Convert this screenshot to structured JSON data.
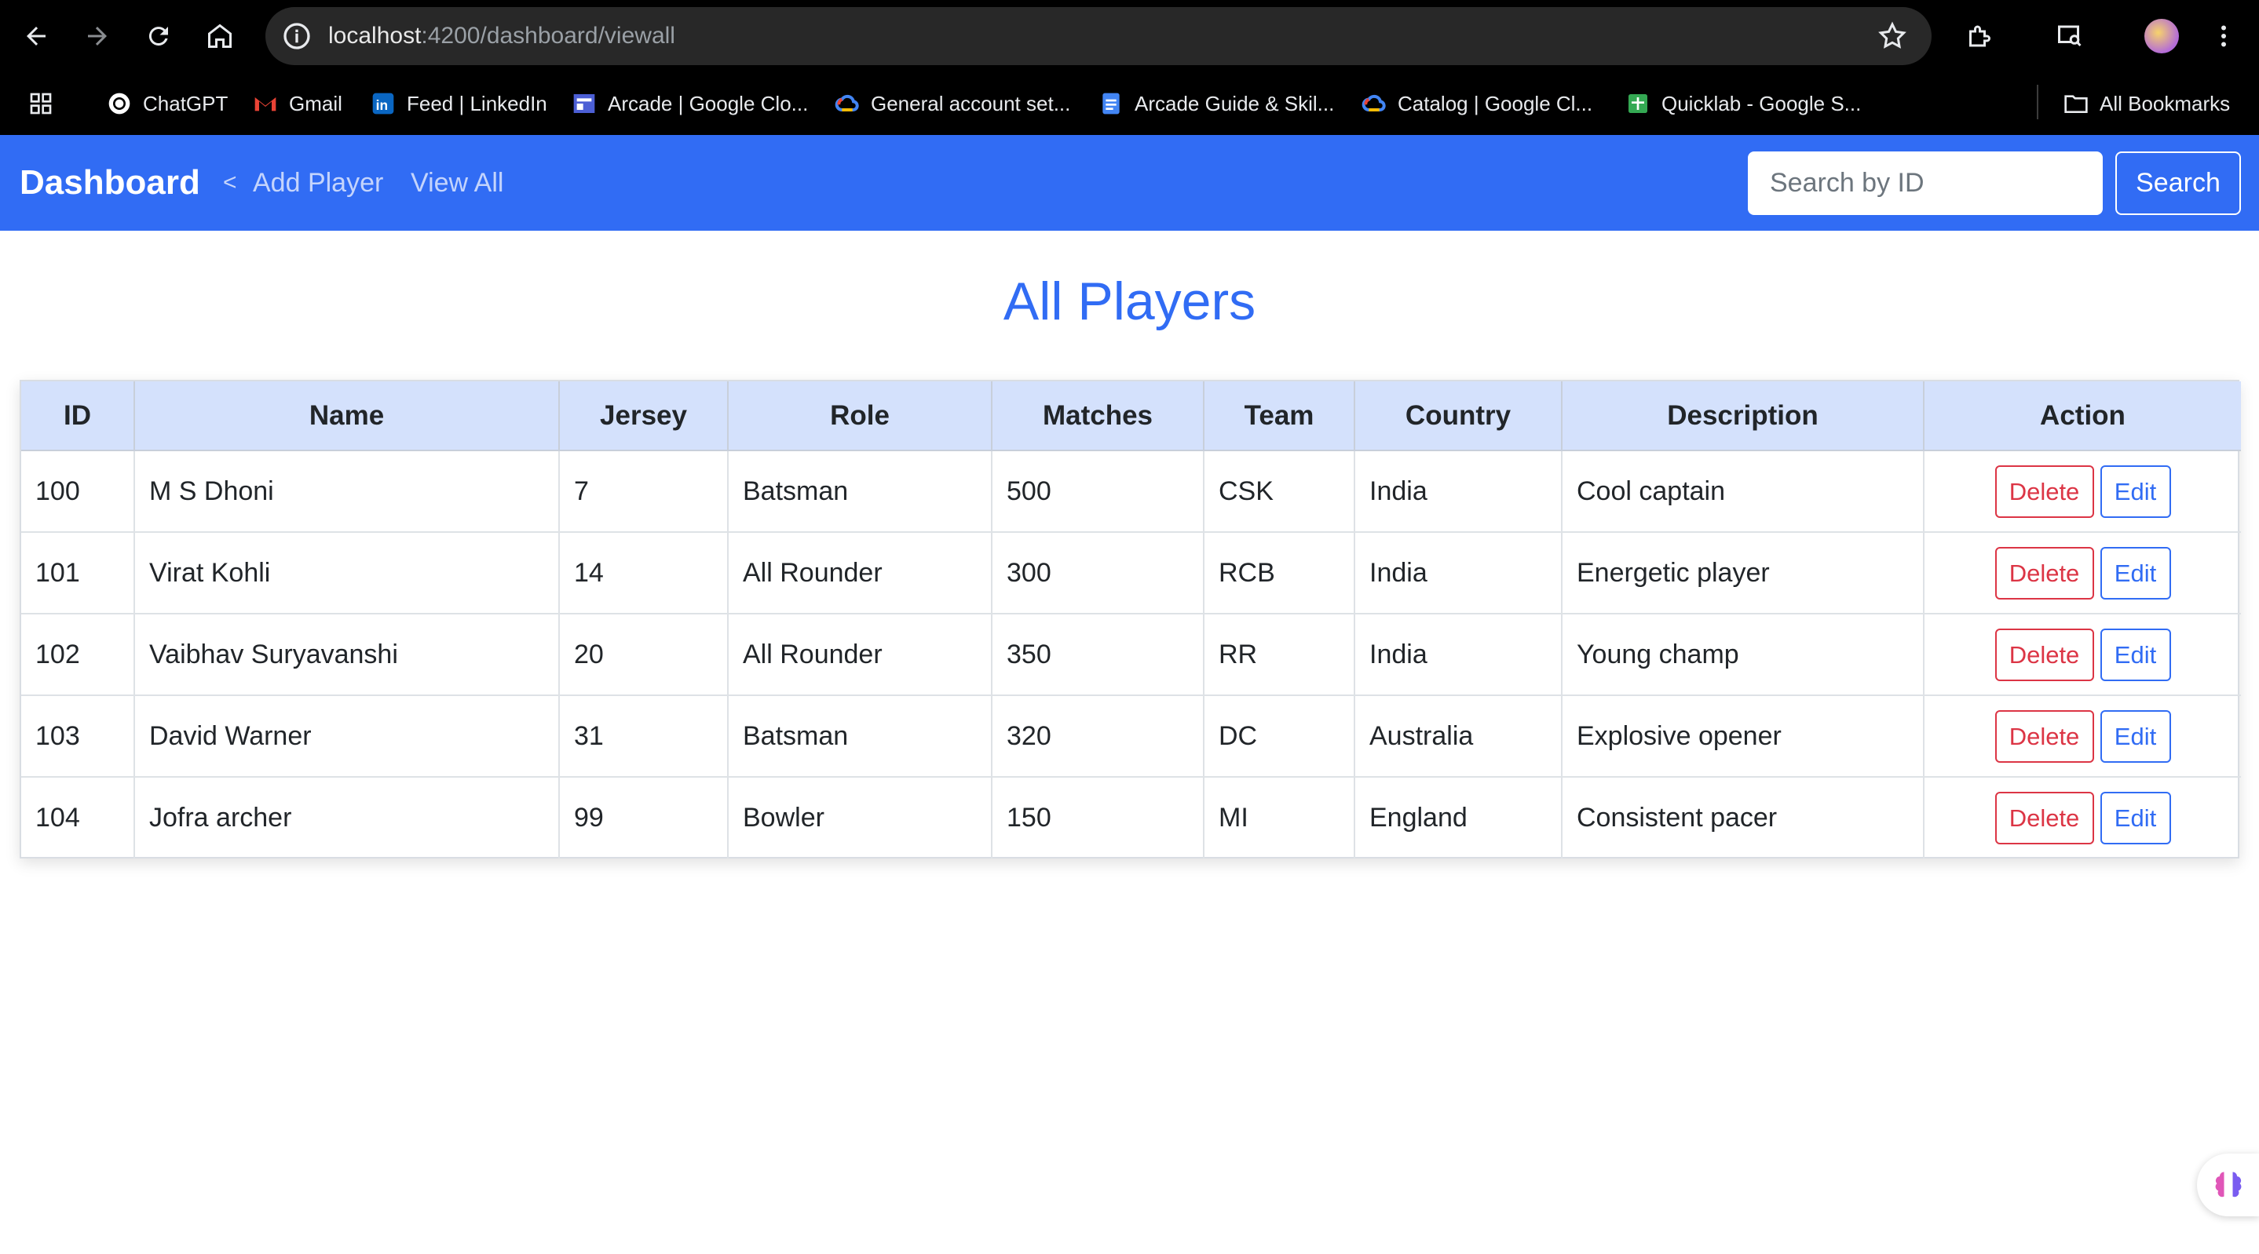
{
  "browser": {
    "url_host": "localhost",
    "url_path": ":4200/dashboard/viewall",
    "bookmarks": [
      {
        "label": "ChatGPT",
        "icon": "chatgpt-icon"
      },
      {
        "label": "Gmail",
        "icon": "gmail-icon"
      },
      {
        "label": "Feed | LinkedIn",
        "icon": "linkedin-icon"
      },
      {
        "label": "Arcade | Google Clo...",
        "icon": "arcade-icon"
      },
      {
        "label": "General account set...",
        "icon": "google-cloud-icon"
      },
      {
        "label": "Arcade Guide & Skil...",
        "icon": "docs-icon"
      },
      {
        "label": "Catalog | Google Cl...",
        "icon": "google-cloud-icon"
      },
      {
        "label": "Quicklab - Google S...",
        "icon": "sheets-icon"
      }
    ],
    "all_bookmarks": "All Bookmarks"
  },
  "navbar": {
    "brand": "Dashboard",
    "chevron": "<",
    "links": [
      "Add Player",
      "View All"
    ],
    "search_placeholder": "Search by ID",
    "search_button": "Search"
  },
  "page": {
    "title": "All Players"
  },
  "table": {
    "headers": [
      "ID",
      "Name",
      "Jersey",
      "Role",
      "Matches",
      "Team",
      "Country",
      "Description",
      "Action"
    ],
    "rows": [
      {
        "id": "100",
        "name": "M S Dhoni",
        "jersey": "7",
        "role": "Batsman",
        "matches": "500",
        "team": "CSK",
        "country": "India",
        "description": "Cool captain"
      },
      {
        "id": "101",
        "name": "Virat Kohli",
        "jersey": "14",
        "role": "All Rounder",
        "matches": "300",
        "team": "RCB",
        "country": "India",
        "description": "Energetic player"
      },
      {
        "id": "102",
        "name": "Vaibhav Suryavanshi",
        "jersey": "20",
        "role": "All Rounder",
        "matches": "350",
        "team": "RR",
        "country": "India",
        "description": "Young champ"
      },
      {
        "id": "103",
        "name": "David Warner",
        "jersey": "31",
        "role": "Batsman",
        "matches": "320",
        "team": "DC",
        "country": "Australia",
        "description": "Explosive opener"
      },
      {
        "id": "104",
        "name": "Jofra archer",
        "jersey": "99",
        "role": "Bowler",
        "matches": "150",
        "team": "MI",
        "country": "England",
        "description": "Consistent pacer"
      }
    ],
    "delete_label": "Delete",
    "edit_label": "Edit"
  },
  "colors": {
    "navbar": "#316cf4",
    "header_bg": "#d4e1fc",
    "delete": "#dc3545",
    "edit": "#316cf4"
  }
}
